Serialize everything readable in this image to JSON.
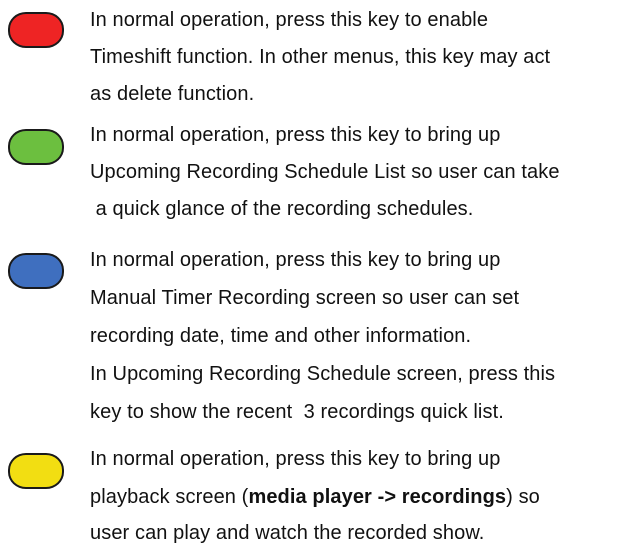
{
  "keys": [
    {
      "icon": "red-key-icon",
      "color": "#ee2424",
      "lines": [
        "In normal operation, press this key to enable",
        "Timeshift function. In other menus, this key may act",
        "as delete function."
      ]
    },
    {
      "icon": "green-key-icon",
      "color": "#6cbf3f",
      "lines": [
        "In normal operation, press this key to bring up",
        "Upcoming Recording Schedule List so user can take",
        " a quick glance of the recording schedules."
      ]
    },
    {
      "icon": "blue-key-icon",
      "color": "#3f6fbf",
      "lines": [
        "In normal operation, press this key to bring up",
        "Manual Timer Recording screen so user can set",
        "recording date, time and other information.",
        "In Upcoming Recording Schedule screen, press this",
        "key to show the recent  3 recordings quick list."
      ]
    },
    {
      "icon": "yellow-key-icon",
      "color": "#f2de12",
      "lines": [
        "In normal operation, press this key to bring up"
      ],
      "line2": {
        "before": "playback screen (",
        "bold": "media player -> recordings",
        "after": ") so"
      },
      "line3": "user can play and watch the recorded show."
    }
  ]
}
